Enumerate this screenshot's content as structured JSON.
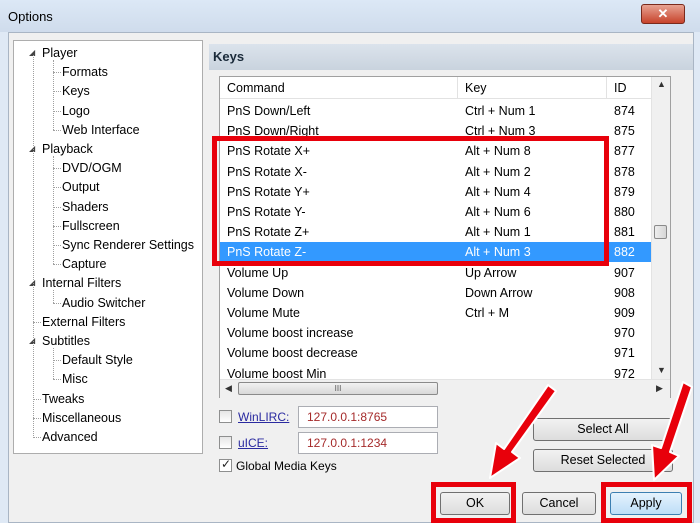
{
  "window": {
    "title": "Options",
    "close_glyph": "✕"
  },
  "tree": {
    "items": [
      {
        "label": "Player",
        "level": 0,
        "expanded": true
      },
      {
        "label": "Formats",
        "level": 1
      },
      {
        "label": "Keys",
        "level": 1
      },
      {
        "label": "Logo",
        "level": 1
      },
      {
        "label": "Web Interface",
        "level": 1
      },
      {
        "label": "Playback",
        "level": 0,
        "expanded": true
      },
      {
        "label": "DVD/OGM",
        "level": 1
      },
      {
        "label": "Output",
        "level": 1
      },
      {
        "label": "Shaders",
        "level": 1
      },
      {
        "label": "Fullscreen",
        "level": 1
      },
      {
        "label": "Sync Renderer Settings",
        "level": 1
      },
      {
        "label": "Capture",
        "level": 1
      },
      {
        "label": "Internal Filters",
        "level": 0,
        "expanded": true
      },
      {
        "label": "Audio Switcher",
        "level": 1
      },
      {
        "label": "External Filters",
        "level": 0
      },
      {
        "label": "Subtitles",
        "level": 0,
        "expanded": true
      },
      {
        "label": "Default Style",
        "level": 1
      },
      {
        "label": "Misc",
        "level": 1
      },
      {
        "label": "Tweaks",
        "level": 0
      },
      {
        "label": "Miscellaneous",
        "level": 0
      },
      {
        "label": "Advanced",
        "level": 0
      }
    ],
    "expand_glyph": "◢"
  },
  "page": {
    "title": "Keys"
  },
  "keys_table": {
    "columns": [
      "Command",
      "Key",
      "ID"
    ],
    "rows": [
      [
        "PnS Down/Left",
        "Ctrl + Num 1",
        "874"
      ],
      [
        "PnS Down/Right",
        "Ctrl + Num 3",
        "875"
      ],
      [
        "PnS Rotate X+",
        "Alt + Num 8",
        "877"
      ],
      [
        "PnS Rotate X-",
        "Alt + Num 2",
        "878"
      ],
      [
        "PnS Rotate Y+",
        "Alt + Num 4",
        "879"
      ],
      [
        "PnS Rotate Y-",
        "Alt + Num 6",
        "880"
      ],
      [
        "PnS Rotate Z+",
        "Alt + Num 1",
        "881"
      ],
      [
        "PnS Rotate Z-",
        "Alt + Num 3",
        "882"
      ],
      [
        "Volume Up",
        "Up Arrow",
        "907"
      ],
      [
        "Volume Down",
        "Down Arrow",
        "908"
      ],
      [
        "Volume Mute",
        "Ctrl + M",
        "909"
      ],
      [
        "Volume boost increase",
        "",
        "970"
      ],
      [
        "Volume boost decrease",
        "",
        "971"
      ],
      [
        "Volume boost Min",
        "",
        "972"
      ]
    ],
    "selected_row": 7,
    "hscroll_grip": "III"
  },
  "remote": {
    "winlirc_label": "WinLIRC:",
    "winlirc_value": "127.0.0.1:8765",
    "uice_label": "uICE:",
    "uice_value": "127.0.0.1:1234",
    "global_media_keys_label": "Global Media Keys",
    "global_media_keys_checked": true
  },
  "buttons": {
    "select_all": "Select All",
    "reset_selected": "Reset Selected",
    "ok": "OK",
    "cancel": "Cancel",
    "apply": "Apply"
  },
  "colors": {
    "annotation": "#e8000b",
    "selection": "#3399ff"
  }
}
